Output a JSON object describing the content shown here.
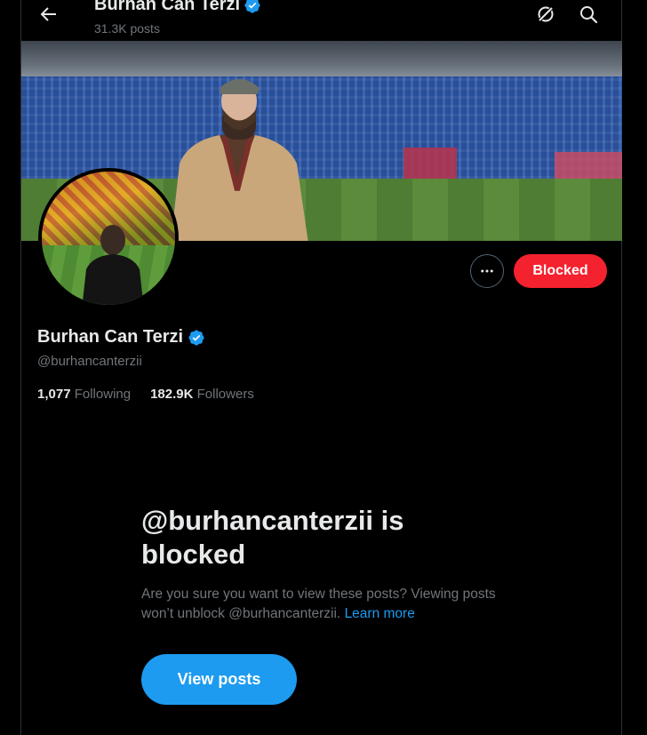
{
  "header": {
    "name": "Burhan Can Terzi",
    "posts_count": "31.3K posts",
    "back_icon": "arrow-left-icon",
    "grok_icon": "grok-icon",
    "search_icon": "search-icon"
  },
  "profile": {
    "name": "Burhan Can Terzi",
    "handle": "@burhancanterzii",
    "verified": true,
    "following_count": "1,077",
    "following_label": "Following",
    "followers_count": "182.9K",
    "followers_label": "Followers"
  },
  "actions": {
    "more_icon": "more-horizontal-icon",
    "blocked_label": "Blocked"
  },
  "blocked_notice": {
    "title": "@burhancanterzii is blocked",
    "body": "Are you sure you want to view these posts? Viewing posts won’t unblock @burhancanterzii.",
    "learn_more": "Learn more",
    "view_posts_label": "View posts"
  },
  "colors": {
    "accent": "#1d9bf0",
    "blocked_red": "#f4212e",
    "background": "#000000",
    "muted_text": "#71767b"
  }
}
